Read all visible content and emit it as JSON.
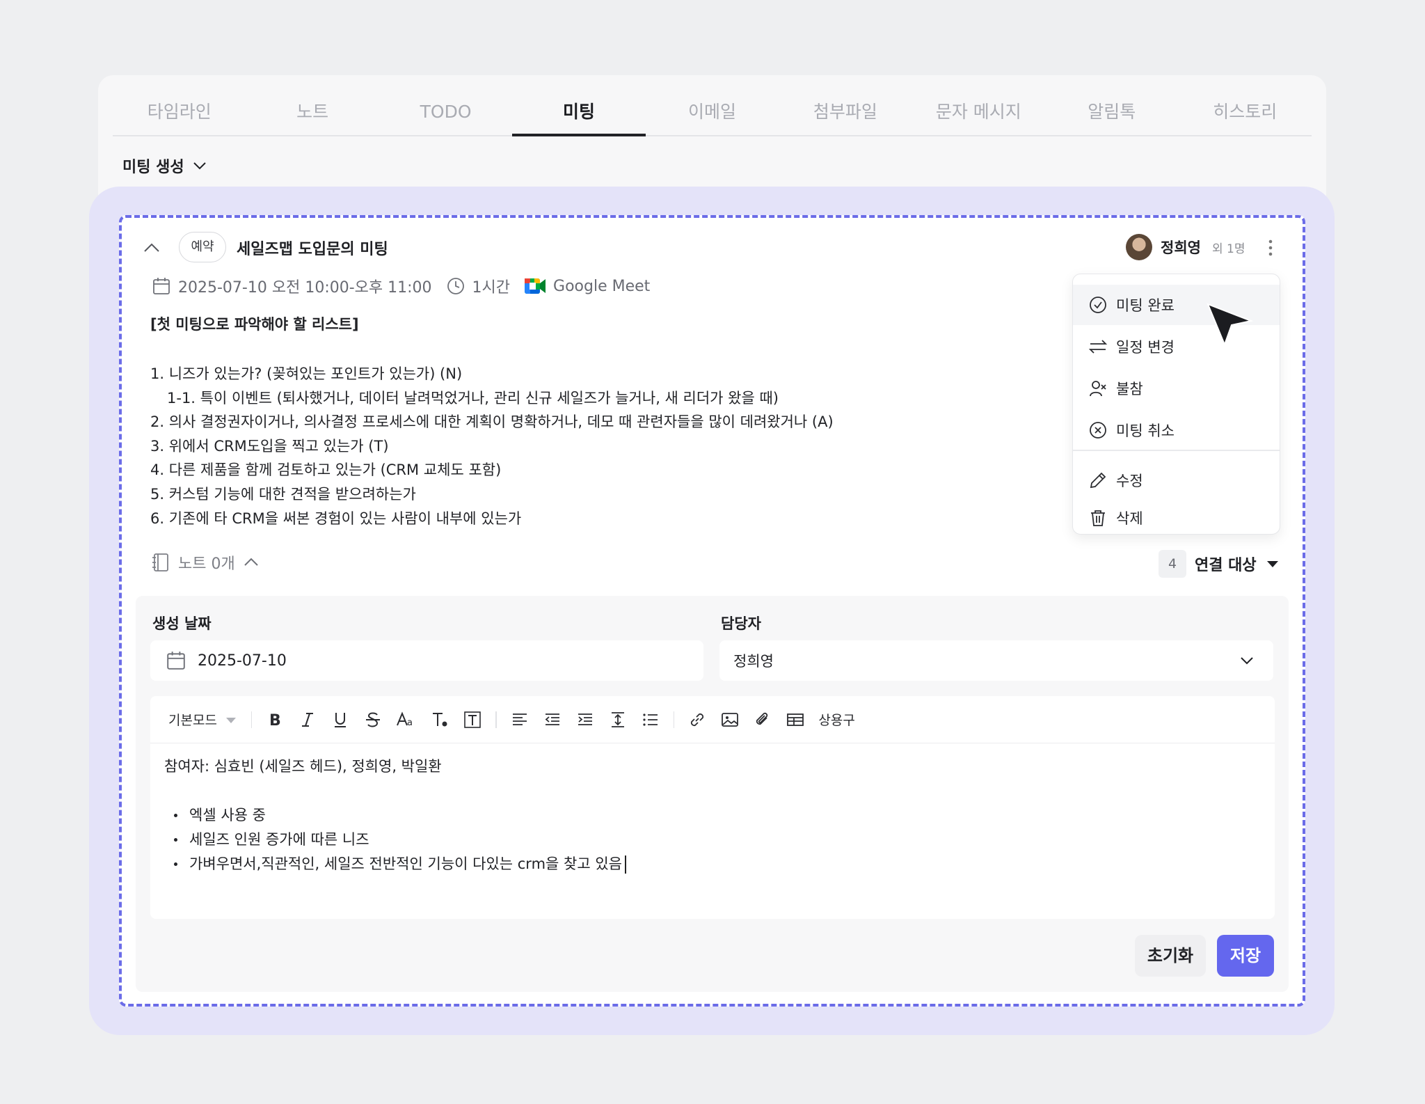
{
  "tabs": [
    "타임라인",
    "노트",
    "TODO",
    "미팅",
    "이메일",
    "첨부파일",
    "문자 메시지",
    "알림톡",
    "히스토리"
  ],
  "active_tab": "미팅",
  "create_dropdown": "미팅 생성",
  "meeting": {
    "status": "예약",
    "title": "세일즈맵 도입문의 미팅",
    "owner": "정희영",
    "owner_extra": "외 1명",
    "datetime": "2025-07-10 오전 10:00-오후 11:00",
    "duration": "1시간",
    "platform": "Google Meet",
    "body_heading": "[첫 미팅으로 파악해야 할 리스트]",
    "body_lines": [
      "1. 니즈가 있는가? (꽂혀있는 포인트가 있는가) (N)",
      "1-1. 특이 이벤트 (퇴사했거나, 데이터 날려먹었거나, 관리 신규 세일즈가 늘거나, 새 리더가 왔을 때)",
      "2. 의사 결정권자이거나, 의사결정 프로세스에 대한 계획이 명확하거나, 데모 때 관련자들을 많이 데려왔거나 (A)",
      "3. 위에서 CRM도입을 찍고 있는가 (T)",
      "4. 다른 제품을 함께 검토하고 있는가 (CRM 교체도 포함)",
      "5. 커스텀 기능에 대한 견적을 받으려하는가",
      "6. 기존에 타 CRM을 써본 경험이 있는 사람이 내부에 있는가"
    ],
    "notes_label": "노트 0개",
    "link_count": "4",
    "link_label": "연결 대상"
  },
  "menu": {
    "items": [
      "미팅 완료",
      "일정 변경",
      "불참",
      "미팅 취소",
      "수정",
      "삭제"
    ]
  },
  "form": {
    "created_label": "생성 날짜",
    "created_value": "2025-07-10",
    "assignee_label": "담당자",
    "assignee_value": "정희영",
    "mode_label": "기본모드",
    "phrases_label": "상용구",
    "content_line1": "참여자: 심효빈 (세일즈 헤드), 정희영, 박일환",
    "bullets": [
      "엑셀 사용 중",
      "세일즈 인원 증가에 따른 니즈",
      "가벼우면서,직관적인, 세일즈 전반적인 기능이 다있는 crm을 찾고 있음"
    ],
    "reset_label": "초기화",
    "save_label": "저장"
  },
  "colors": {
    "accent": "#6467ee",
    "dash": "#6b6ce8",
    "halo": "#e4e3f9"
  }
}
